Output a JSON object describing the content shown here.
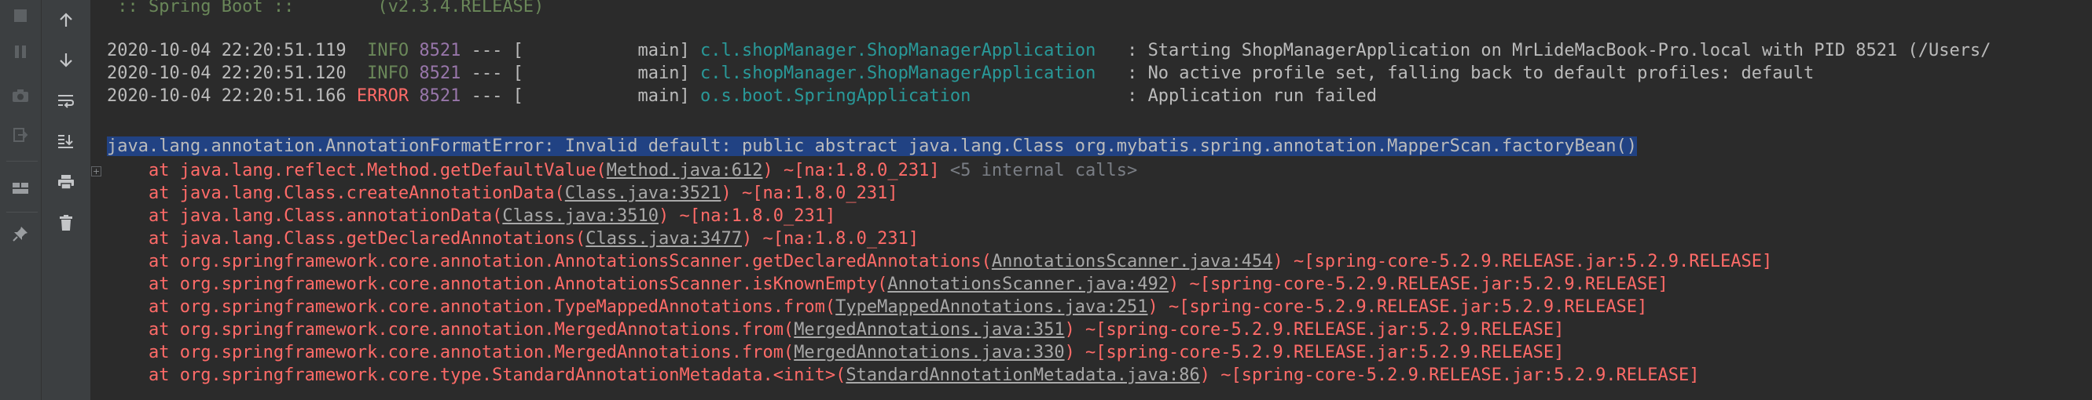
{
  "toolbar_left": [
    {
      "name": "stop-icon"
    },
    {
      "name": "pause-icon"
    },
    {
      "name": "camera-icon"
    },
    {
      "name": "exit-icon"
    },
    {
      "name": "layout-icon"
    },
    {
      "name": "pin-icon"
    }
  ],
  "toolbar_right": [
    {
      "name": "arrow-up-icon"
    },
    {
      "name": "arrow-down-icon"
    },
    {
      "name": "soft-wrap-icon"
    },
    {
      "name": "scroll-to-end-icon"
    },
    {
      "name": "print-icon"
    },
    {
      "name": "trash-icon"
    }
  ],
  "console": {
    "banner": " :: Spring Boot ::        (v2.3.4.RELEASE)",
    "log_lines": [
      {
        "timestamp": "2020-10-04 22:20:51.119",
        "level": " INFO",
        "pid": "8521",
        "sep": " --- [",
        "thread": "           main]",
        "logger": "c.l.shopManager.ShopManagerApplication  ",
        "message": " : Starting ShopManagerApplication on MrLideMacBook-Pro.local with PID 8521 (/Users/"
      },
      {
        "timestamp": "2020-10-04 22:20:51.120",
        "level": " INFO",
        "pid": "8521",
        "sep": " --- [",
        "thread": "           main]",
        "logger": "c.l.shopManager.ShopManagerApplication  ",
        "message": " : No active profile set, falling back to default profiles: default"
      },
      {
        "timestamp": "2020-10-04 22:20:51.166",
        "level": "ERROR",
        "pid": "8521",
        "sep": " --- [",
        "thread": "           main]",
        "logger": "o.s.boot.SpringApplication              ",
        "message": " : Application run failed"
      }
    ],
    "exception": "java.lang.annotation.AnnotationFormatError: Invalid default: public abstract java.lang.Class org.mybatis.spring.annotation.MapperScan.factoryBean()",
    "fold_label": "+",
    "stack": [
      {
        "prefix": "    at java.lang.reflect.Method.getDefaultValue(",
        "link": "Method.java:612",
        "suffix": ") ~[na:1.8.0_231] ",
        "extra": "<5 internal calls>"
      },
      {
        "prefix": "    at java.lang.Class.createAnnotationData(",
        "link": "Class.java:3521",
        "suffix": ") ~[na:1.8.0_231]",
        "extra": ""
      },
      {
        "prefix": "    at java.lang.Class.annotationData(",
        "link": "Class.java:3510",
        "suffix": ") ~[na:1.8.0_231]",
        "extra": ""
      },
      {
        "prefix": "    at java.lang.Class.getDeclaredAnnotations(",
        "link": "Class.java:3477",
        "suffix": ") ~[na:1.8.0_231]",
        "extra": ""
      },
      {
        "prefix": "    at org.springframework.core.annotation.AnnotationsScanner.getDeclaredAnnotations(",
        "link": "AnnotationsScanner.java:454",
        "suffix": ") ~[spring-core-5.2.9.RELEASE.jar:5.2.9.RELEASE]",
        "extra": ""
      },
      {
        "prefix": "    at org.springframework.core.annotation.AnnotationsScanner.isKnownEmpty(",
        "link": "AnnotationsScanner.java:492",
        "suffix": ") ~[spring-core-5.2.9.RELEASE.jar:5.2.9.RELEASE]",
        "extra": ""
      },
      {
        "prefix": "    at org.springframework.core.annotation.TypeMappedAnnotations.from(",
        "link": "TypeMappedAnnotations.java:251",
        "suffix": ") ~[spring-core-5.2.9.RELEASE.jar:5.2.9.RELEASE]",
        "extra": ""
      },
      {
        "prefix": "    at org.springframework.core.annotation.MergedAnnotations.from(",
        "link": "MergedAnnotations.java:351",
        "suffix": ") ~[spring-core-5.2.9.RELEASE.jar:5.2.9.RELEASE]",
        "extra": ""
      },
      {
        "prefix": "    at org.springframework.core.annotation.MergedAnnotations.from(",
        "link": "MergedAnnotations.java:330",
        "suffix": ") ~[spring-core-5.2.9.RELEASE.jar:5.2.9.RELEASE]",
        "extra": ""
      },
      {
        "prefix": "    at org.springframework.core.type.StandardAnnotationMetadata.<init>(",
        "link": "StandardAnnotationMetadata.java:86",
        "suffix": ") ~[spring-core-5.2.9.RELEASE.jar:5.2.9.RELEASE]",
        "extra": ""
      }
    ]
  }
}
